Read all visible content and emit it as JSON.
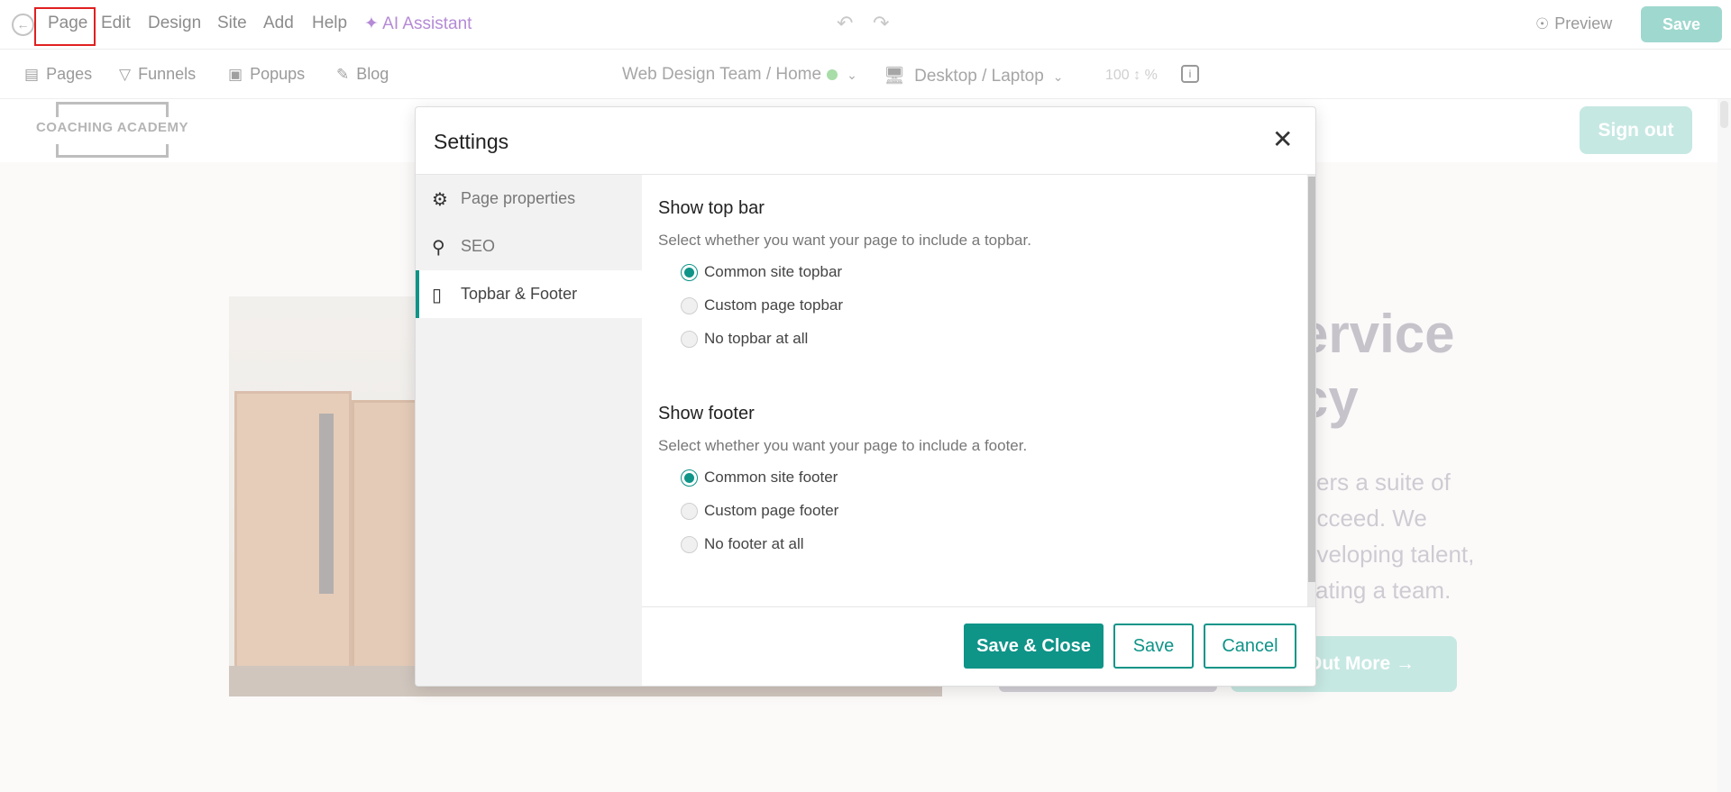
{
  "topbar": {
    "menu": [
      "Page",
      "Edit",
      "Design",
      "Site",
      "Add",
      "Help"
    ],
    "ai_assistant": "AI Assistant",
    "preview": "Preview",
    "save": "Save"
  },
  "subbar": {
    "items": [
      "Pages",
      "Funnels",
      "Popups",
      "Blog"
    ],
    "breadcrumb": "Web Design Team / Home",
    "device": "Desktop / Laptop",
    "zoom_value": "100",
    "zoom_unit": "%"
  },
  "site": {
    "logo": "COACHING ACADEMY",
    "sign_out": "Sign out",
    "hero_title_line1": "ervice",
    "hero_title_line2": "cy",
    "hero_para": [
      "ffers a suite of",
      "ucceed. We",
      "eveloping talent,",
      "vating a team."
    ],
    "hero_button": "Out More →"
  },
  "modal": {
    "title": "Settings",
    "sidebar": [
      {
        "label": "Page properties",
        "icon": "gear-icon"
      },
      {
        "label": "SEO",
        "icon": "search-icon"
      },
      {
        "label": "Topbar & Footer",
        "icon": "layout-icon"
      }
    ],
    "topbar_section": {
      "title": "Show top bar",
      "desc": "Select whether you want your page to include a topbar.",
      "options": [
        "Common site topbar",
        "Custom page topbar",
        "No topbar at all"
      ],
      "selected": 0
    },
    "footer_section": {
      "title": "Show footer",
      "desc": "Select whether you want your page to include a footer.",
      "options": [
        "Common site footer",
        "Custom page footer",
        "No footer at all"
      ],
      "selected": 0
    },
    "buttons": {
      "save_close": "Save & Close",
      "save": "Save",
      "cancel": "Cancel"
    }
  },
  "colors": {
    "accent": "#0f9488",
    "accent_light": "#a8dcd3",
    "highlight_box": "#e02020"
  }
}
